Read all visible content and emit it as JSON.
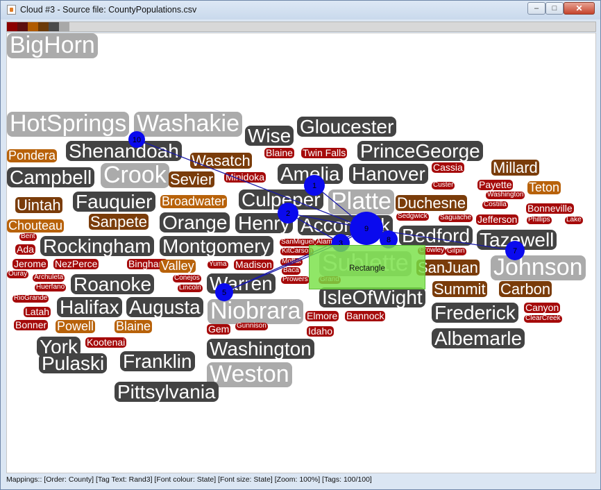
{
  "window": {
    "title": "Cloud #3 - Source file: CountyPopulations.csv",
    "controls": {
      "minimize": "–",
      "maximize": "□",
      "close": "✕"
    }
  },
  "palette": [
    "#8b0000",
    "#5c0f0f",
    "#b05b00",
    "#6b3a08",
    "#4a4a4a",
    "#a8a8a8"
  ],
  "colors": {
    "red": "#a50a0a",
    "maroon": "#6e0a0a",
    "orange": "#b8620a",
    "brown": "#7a3c0a",
    "dark": "#434343",
    "light": "#ababab",
    "node": "#0a0aee",
    "link": "#1a1aa8",
    "rect": "#78e046"
  },
  "tags": [
    {
      "t": "HotSprings",
      "c": "light",
      "s": 34
    },
    {
      "t": "Washakie",
      "c": "light",
      "s": 34
    },
    {
      "t": "Wise",
      "c": "dark",
      "s": 28
    },
    {
      "t": "Gloucester",
      "c": "dark",
      "s": 28
    },
    {
      "t": "Shenandoah",
      "c": "dark",
      "s": 28
    },
    {
      "t": "Pondera",
      "c": "orange",
      "s": 18
    },
    {
      "t": "Wasatch",
      "c": "brown",
      "s": 22
    },
    {
      "t": "Blaine",
      "c": "red",
      "s": 14
    },
    {
      "t": "Twin Falls",
      "c": "red",
      "s": 14
    },
    {
      "t": "PrinceGeorge",
      "c": "dark",
      "s": 28
    },
    {
      "t": "Campbell",
      "c": "dark",
      "s": 28
    },
    {
      "t": "Crook",
      "c": "light",
      "s": 34
    },
    {
      "t": "Minidoka",
      "c": "red",
      "s": 14
    },
    {
      "t": "Amelia",
      "c": "dark",
      "s": 28
    },
    {
      "t": "Hanover",
      "c": "dark",
      "s": 28
    },
    {
      "t": "Cassia",
      "c": "red",
      "s": 14
    },
    {
      "t": "Millard",
      "c": "brown",
      "s": 22
    },
    {
      "t": "Sevier",
      "c": "brown",
      "s": 22
    },
    {
      "t": "Custer",
      "c": "red",
      "s": 10
    },
    {
      "t": "Payette",
      "c": "red",
      "s": 14
    },
    {
      "t": "Teton",
      "c": "orange",
      "s": 18
    },
    {
      "t": "Uintah",
      "c": "brown",
      "s": 22
    },
    {
      "t": "Fauquier",
      "c": "dark",
      "s": 28
    },
    {
      "t": "Broadwater",
      "c": "orange",
      "s": 18
    },
    {
      "t": "Culpeper",
      "c": "dark",
      "s": 28
    },
    {
      "t": "Platte",
      "c": "light",
      "s": 34
    },
    {
      "t": "Duchesne",
      "c": "brown",
      "s": 22
    },
    {
      "t": "Washington",
      "c": "red",
      "s": 10
    },
    {
      "t": "Costilla",
      "c": "red",
      "s": 10
    },
    {
      "t": "Bonneville",
      "c": "red",
      "s": 14
    },
    {
      "t": "Chouteau",
      "c": "orange",
      "s": 18
    },
    {
      "t": "Sanpete",
      "c": "brown",
      "s": 22
    },
    {
      "t": "Orange",
      "c": "dark",
      "s": 28
    },
    {
      "t": "Henry",
      "c": "dark",
      "s": 28
    },
    {
      "t": "Accomack",
      "c": "dark",
      "s": 28
    },
    {
      "t": "Sedgwick",
      "c": "red",
      "s": 10
    },
    {
      "t": "Saguache",
      "c": "red",
      "s": 10
    },
    {
      "t": "Jefferson",
      "c": "red",
      "s": 14
    },
    {
      "t": "Phillips",
      "c": "red",
      "s": 10
    },
    {
      "t": "Lake",
      "c": "red",
      "s": 10
    },
    {
      "t": "Bent",
      "c": "red",
      "s": 10
    },
    {
      "t": "Rockingham",
      "c": "dark",
      "s": 28
    },
    {
      "t": "Montgomery",
      "c": "dark",
      "s": 28
    },
    {
      "t": "Bedford",
      "c": "dark",
      "s": 28
    },
    {
      "t": "Tazewell",
      "c": "dark",
      "s": 28
    },
    {
      "t": "Ada",
      "c": "red",
      "s": 14
    },
    {
      "t": "SanMiguel",
      "c": "red",
      "s": 10
    },
    {
      "t": "Alamosa",
      "c": "red",
      "s": 10
    },
    {
      "t": "KitCarson",
      "c": "red",
      "s": 10
    },
    {
      "t": "Crowley",
      "c": "red",
      "s": 10
    },
    {
      "t": "Gilpin",
      "c": "red",
      "s": 10
    },
    {
      "t": "Jerome",
      "c": "red",
      "s": 14
    },
    {
      "t": "NezPerce",
      "c": "red",
      "s": 14
    },
    {
      "t": "Bingham",
      "c": "red",
      "s": 14
    },
    {
      "t": "Valley",
      "c": "orange",
      "s": 18
    },
    {
      "t": "Yuma",
      "c": "red",
      "s": 10
    },
    {
      "t": "Madison",
      "c": "red",
      "s": 14
    },
    {
      "t": "Moffat",
      "c": "red",
      "s": 10
    },
    {
      "t": "Sublette",
      "c": "light",
      "s": 34
    },
    {
      "t": "SanJuan",
      "c": "brown",
      "s": 22
    },
    {
      "t": "Johnson",
      "c": "light",
      "s": 34
    },
    {
      "t": "Ouray",
      "c": "red",
      "s": 10
    },
    {
      "t": "Archuleta",
      "c": "red",
      "s": 10
    },
    {
      "t": "Baca",
      "c": "red",
      "s": 10
    },
    {
      "t": "Roanoke",
      "c": "dark",
      "s": 28
    },
    {
      "t": "Conejos",
      "c": "red",
      "s": 10
    },
    {
      "t": "Warren",
      "c": "dark",
      "s": 28
    },
    {
      "t": "Huerfano",
      "c": "red",
      "s": 10
    },
    {
      "t": "Lincoln",
      "c": "red",
      "s": 10
    },
    {
      "t": "Prowers",
      "c": "red",
      "s": 10
    },
    {
      "t": "Grand",
      "c": "red",
      "s": 10
    },
    {
      "t": "Summit",
      "c": "brown",
      "s": 22
    },
    {
      "t": "Carbon",
      "c": "brown",
      "s": 22
    },
    {
      "t": "RioGrande",
      "c": "red",
      "s": 10
    },
    {
      "t": "IsleOfWight",
      "c": "dark",
      "s": 28
    },
    {
      "t": "Canyon",
      "c": "red",
      "s": 14
    },
    {
      "t": "Halifax",
      "c": "dark",
      "s": 28
    },
    {
      "t": "Augusta",
      "c": "dark",
      "s": 28
    },
    {
      "t": "Niobrara",
      "c": "light",
      "s": 34
    },
    {
      "t": "Latah",
      "c": "red",
      "s": 14
    },
    {
      "t": "Elmore",
      "c": "red",
      "s": 14
    },
    {
      "t": "Bannock",
      "c": "red",
      "s": 14
    },
    {
      "t": "ClearCreek",
      "c": "red",
      "s": 10
    },
    {
      "t": "Bonner",
      "c": "red",
      "s": 14
    },
    {
      "t": "Powell",
      "c": "orange",
      "s": 18
    },
    {
      "t": "Blaine",
      "c": "orange",
      "s": 18
    },
    {
      "t": "Frederick",
      "c": "dark",
      "s": 28
    },
    {
      "t": "Gem",
      "c": "red",
      "s": 14
    },
    {
      "t": "Gunnison",
      "c": "red",
      "s": 10
    },
    {
      "t": "York",
      "c": "dark",
      "s": 28
    },
    {
      "t": "Kootenai",
      "c": "red",
      "s": 14
    },
    {
      "t": "Idaho",
      "c": "red",
      "s": 14
    },
    {
      "t": "Albemarle",
      "c": "dark",
      "s": 28
    },
    {
      "t": "Washington",
      "c": "dark",
      "s": 28
    },
    {
      "t": "Pulaski",
      "c": "dark",
      "s": 28
    },
    {
      "t": "Franklin",
      "c": "dark",
      "s": 28
    },
    {
      "t": "Weston",
      "c": "light",
      "s": 34
    },
    {
      "t": "Pittsylvania",
      "c": "dark",
      "s": 28
    },
    {
      "t": "BigHorn",
      "c": "light",
      "s": 34
    }
  ],
  "nodes": [
    "10",
    "1",
    "2",
    "3",
    "9",
    "8",
    "7",
    "5"
  ],
  "rectangle_label": "Rectangle",
  "status": "Mappings:: [Order: County]  [Tag Text: Rand3]  [Font colour: State]  [Font size: State]  [Zoom: 100%]  [Tags: 100/100]"
}
